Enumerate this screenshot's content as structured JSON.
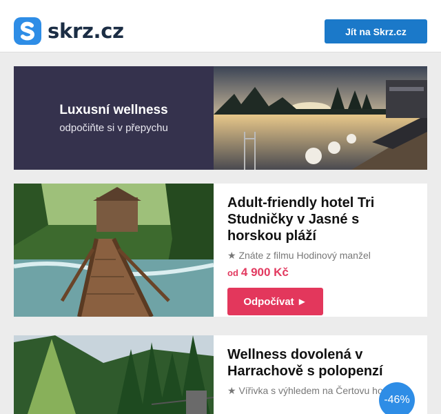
{
  "header": {
    "logo_text": "skrz.cz",
    "cta_label": "Jít na Skrz.cz"
  },
  "banner": {
    "title": "Luxusní wellness",
    "subtitle": "odpočiňte si v přepychu"
  },
  "offers": [
    {
      "title": "Adult-friendly hotel Tri Studničky v Jasné s horskou pláží",
      "note": "★ Znáte z filmu Hodinový manžel",
      "price_prefix": "od",
      "price": "4 900 Kč",
      "button_label": "Odpočívat ►"
    },
    {
      "title": "Wellness dovolená v Harrachově s polopenzí",
      "note": "★ Vířivka s výhledem na Čertovu horu",
      "discount": "-46%"
    }
  ],
  "colors": {
    "brand_blue": "#2e8de6",
    "cta_blue": "#1b79c9",
    "accent_red": "#e3375c",
    "banner_bg": "#35324d"
  }
}
